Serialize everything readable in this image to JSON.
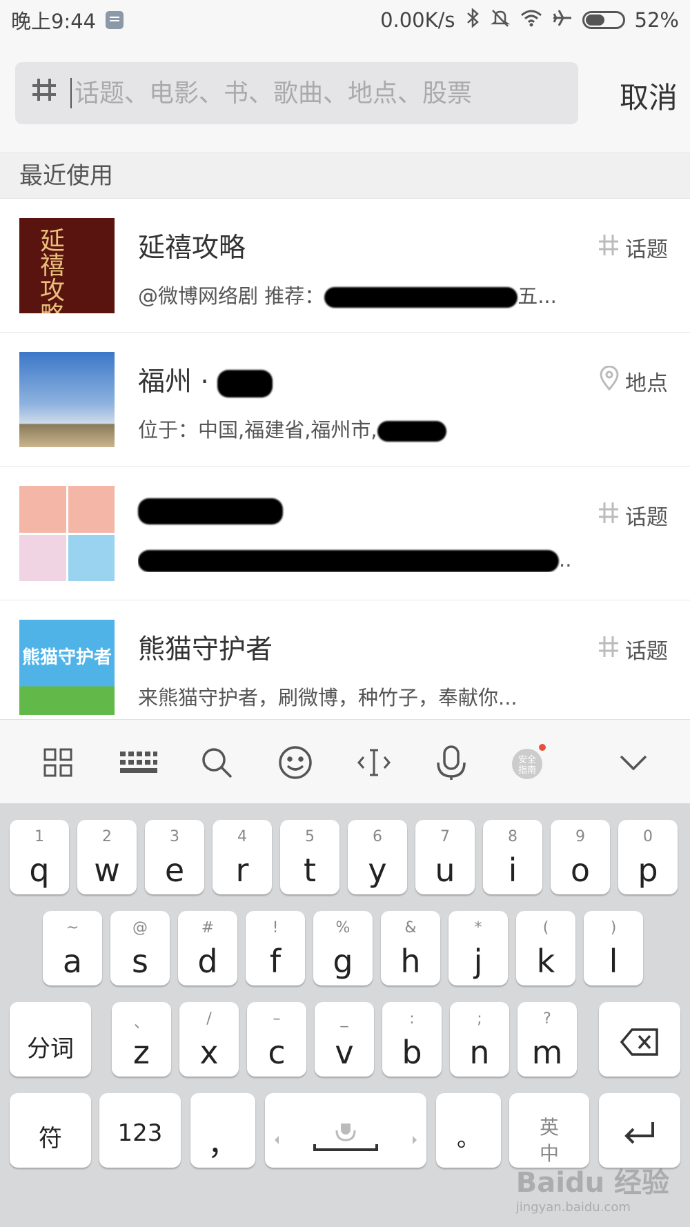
{
  "status": {
    "time": "晚上9:44",
    "net_speed": "0.00K/s",
    "battery": "52%"
  },
  "search": {
    "hash_glyph": "#",
    "placeholder": "话题、电影、书、歌曲、地点、股票",
    "cancel_label": "取消"
  },
  "section": {
    "title": "最近使用"
  },
  "results": [
    {
      "title": "延禧攻略",
      "subtitle": "@微博网络剧 推荐：",
      "subtitle_tail": "五...",
      "type_label": "话题",
      "type_icon": "hash-icon"
    },
    {
      "title": "福州 ·",
      "subtitle": "位于：中国,福建省,福州市,",
      "subtitle_tail": "",
      "type_label": "地点",
      "type_icon": "location-pin-icon"
    },
    {
      "title": "",
      "subtitle": "",
      "subtitle_tail": "...",
      "type_label": "话题",
      "type_icon": "hash-icon"
    },
    {
      "title": "熊猫守护者",
      "subtitle": "来熊猫守护者，刷微博，种竹子，奉献你...",
      "subtitle_tail": "",
      "type_label": "话题",
      "type_icon": "hash-icon"
    }
  ],
  "thumb_text": {
    "t1": "延禧攻略",
    "t4": "熊猫守护者"
  },
  "toolbar": {
    "icons": [
      "grid-icon",
      "keyboard-icon",
      "search-icon",
      "emoji-icon",
      "cursor-icon",
      "microphone-icon",
      "safety-guide-icon",
      "chevron-down-icon"
    ]
  },
  "keyboard": {
    "row1": [
      {
        "alt": "1",
        "key": "q"
      },
      {
        "alt": "2",
        "key": "w"
      },
      {
        "alt": "3",
        "key": "e"
      },
      {
        "alt": "4",
        "key": "r"
      },
      {
        "alt": "5",
        "key": "t"
      },
      {
        "alt": "6",
        "key": "y"
      },
      {
        "alt": "7",
        "key": "u"
      },
      {
        "alt": "8",
        "key": "i"
      },
      {
        "alt": "9",
        "key": "o"
      },
      {
        "alt": "0",
        "key": "p"
      }
    ],
    "row2": [
      {
        "alt": "~",
        "key": "a"
      },
      {
        "alt": "@",
        "key": "s"
      },
      {
        "alt": "#",
        "key": "d"
      },
      {
        "alt": "!",
        "key": "f"
      },
      {
        "alt": "%",
        "key": "g"
      },
      {
        "alt": "&",
        "key": "h"
      },
      {
        "alt": "*",
        "key": "j"
      },
      {
        "alt": "(",
        "key": "k"
      },
      {
        "alt": ")",
        "key": "l"
      }
    ],
    "row3": [
      {
        "alt": "、",
        "key": "z"
      },
      {
        "alt": "/",
        "key": "x"
      },
      {
        "alt": "–",
        "key": "c"
      },
      {
        "alt": "_",
        "key": "v"
      },
      {
        "alt": ":",
        "key": "b"
      },
      {
        "alt": ";",
        "key": "n"
      },
      {
        "alt": "?",
        "key": "m"
      }
    ],
    "fenci": "分词",
    "fu": "符",
    "num": "123",
    "comma": "，",
    "period": "。",
    "lang": "英",
    "lang2": "中"
  },
  "watermark": {
    "main": "Baidu 经验",
    "sub": "jingyan.baidu.com"
  }
}
